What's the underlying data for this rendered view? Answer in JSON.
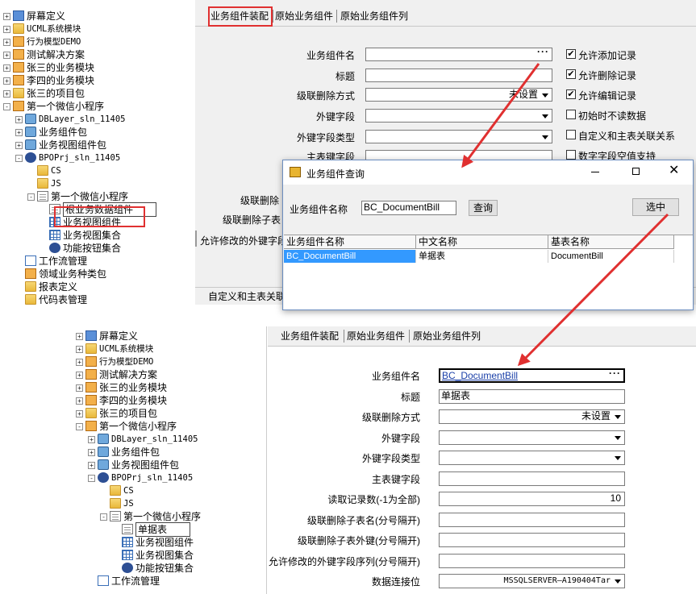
{
  "top": {
    "tree": [
      {
        "label": "屏幕定义",
        "level": 0,
        "exp": "+",
        "icon": "screen-icon",
        "mono": false
      },
      {
        "label": "UCML系统模块",
        "level": 0,
        "exp": "+",
        "icon": "folder-icon",
        "mono": true
      },
      {
        "label": "行为模型DEMO",
        "level": 0,
        "exp": "+",
        "icon": "model-icon",
        "mono": true
      },
      {
        "label": "测试解决方案",
        "level": 0,
        "exp": "+",
        "icon": "model-icon",
        "mono": false
      },
      {
        "label": "张三的业务模块",
        "level": 0,
        "exp": "+",
        "icon": "model-icon",
        "mono": false
      },
      {
        "label": "李四的业务模块",
        "level": 0,
        "exp": "+",
        "icon": "model-icon",
        "mono": false
      },
      {
        "label": "张三的项目包",
        "level": 0,
        "exp": "+",
        "icon": "folder-icon",
        "mono": false
      },
      {
        "label": "第一个微信小程序",
        "level": 0,
        "exp": "-",
        "icon": "model-icon",
        "mono": false
      },
      {
        "label": "DBLayer_sln_11405",
        "level": 1,
        "exp": "+",
        "icon": "package-icon",
        "mono": true
      },
      {
        "label": "业务组件包",
        "level": 1,
        "exp": "+",
        "icon": "package-icon",
        "mono": false
      },
      {
        "label": "业务视图组件包",
        "level": 1,
        "exp": "+",
        "icon": "package-icon",
        "mono": false
      },
      {
        "label": "BPOPrj_sln_11405",
        "level": 1,
        "exp": "-",
        "icon": "gear-icon",
        "mono": true
      },
      {
        "label": "CS",
        "level": 2,
        "exp": "",
        "icon": "folder-icon",
        "mono": true
      },
      {
        "label": "JS",
        "level": 2,
        "exp": "",
        "icon": "folder-icon",
        "mono": true
      },
      {
        "label": "第一个微信小程序",
        "level": 2,
        "exp": "-",
        "icon": "page-icon",
        "mono": false
      },
      {
        "label": "根业务数据组件",
        "level": 3,
        "exp": "",
        "icon": "doc-icon",
        "mono": false
      },
      {
        "label": "业务视图组件",
        "level": 3,
        "exp": "",
        "icon": "grid-icon",
        "mono": false
      },
      {
        "label": "业务视图集合",
        "level": 3,
        "exp": "",
        "icon": "grid-icon",
        "mono": false
      },
      {
        "label": "功能按钮集合",
        "level": 3,
        "exp": "",
        "icon": "gear-icon",
        "mono": false
      },
      {
        "label": "工作流管理",
        "level": 1,
        "exp": "",
        "icon": "flow-icon",
        "mono": false
      },
      {
        "label": "领域业务种类包",
        "level": 1,
        "exp": "",
        "icon": "model-icon",
        "mono": false
      },
      {
        "label": "报表定义",
        "level": 1,
        "exp": "",
        "icon": "folder-icon",
        "mono": false
      },
      {
        "label": "代码表管理",
        "level": 1,
        "exp": "",
        "icon": "folder-icon",
        "mono": false
      }
    ],
    "tabs": [
      "业务组件装配",
      "原始业务组件",
      "原始业务组件列"
    ],
    "form": {
      "component_name_label": "业务组件名",
      "title_label": "标题",
      "cascade_label": "级联删除方式",
      "cascade_value": "未设置",
      "fk_label": "外键字段",
      "fk_type_label": "外键字段类型",
      "pk_label": "主表键字段",
      "read_label": "读取",
      "cascade_table_label": "级联删除",
      "cascade_fk_label": "级联删除子表",
      "allow_fk_label": "允许修改的外键字段"
    },
    "checkboxes": [
      {
        "label": "允许添加记录",
        "checked": true
      },
      {
        "label": "允许删除记录",
        "checked": true
      },
      {
        "label": "允许编辑记录",
        "checked": true
      },
      {
        "label": "初始时不读数据",
        "checked": false
      },
      {
        "label": "自定义和主表关联关系",
        "checked": false
      },
      {
        "label": "数字字段空值支持",
        "checked": false
      }
    ],
    "bottom_tab": "自定义和主表关联"
  },
  "dialog": {
    "title": "业务组件查询",
    "name_label": "业务组件名称",
    "name_value": "BC_DocumentBill",
    "query_button": "查询",
    "select_button": "选中",
    "columns": [
      "业务组件名称",
      "中文名称",
      "基表名称"
    ],
    "rows": [
      [
        "BC_DocumentBill",
        "单据表",
        "DocumentBill"
      ]
    ]
  },
  "bottom": {
    "tree": [
      {
        "label": "屏幕定义",
        "level": 0,
        "exp": "+",
        "icon": "screen-icon",
        "mono": false
      },
      {
        "label": "UCML系统模块",
        "level": 0,
        "exp": "+",
        "icon": "folder-icon",
        "mono": true
      },
      {
        "label": "行为模型DEMO",
        "level": 0,
        "exp": "+",
        "icon": "model-icon",
        "mono": true
      },
      {
        "label": "测试解决方案",
        "level": 0,
        "exp": "+",
        "icon": "model-icon",
        "mono": false
      },
      {
        "label": "张三的业务模块",
        "level": 0,
        "exp": "+",
        "icon": "model-icon",
        "mono": false
      },
      {
        "label": "李四的业务模块",
        "level": 0,
        "exp": "+",
        "icon": "model-icon",
        "mono": false
      },
      {
        "label": "张三的项目包",
        "level": 0,
        "exp": "+",
        "icon": "folder-icon",
        "mono": false
      },
      {
        "label": "第一个微信小程序",
        "level": 0,
        "exp": "-",
        "icon": "model-icon",
        "mono": false
      },
      {
        "label": "DBLayer_sln_11405",
        "level": 1,
        "exp": "+",
        "icon": "package-icon",
        "mono": true
      },
      {
        "label": "业务组件包",
        "level": 1,
        "exp": "+",
        "icon": "package-icon",
        "mono": false
      },
      {
        "label": "业务视图组件包",
        "level": 1,
        "exp": "+",
        "icon": "package-icon",
        "mono": false
      },
      {
        "label": "BPOPrj_sln_11405",
        "level": 1,
        "exp": "-",
        "icon": "gear-icon",
        "mono": true
      },
      {
        "label": "CS",
        "level": 2,
        "exp": "",
        "icon": "folder-icon",
        "mono": true
      },
      {
        "label": "JS",
        "level": 2,
        "exp": "",
        "icon": "folder-icon",
        "mono": true
      },
      {
        "label": "第一个微信小程序",
        "level": 2,
        "exp": "-",
        "icon": "page-icon",
        "mono": false
      },
      {
        "label": "单据表",
        "level": 3,
        "exp": "",
        "icon": "doc-icon",
        "mono": false
      },
      {
        "label": "业务视图组件",
        "level": 3,
        "exp": "",
        "icon": "grid-icon",
        "mono": false
      },
      {
        "label": "业务视图集合",
        "level": 3,
        "exp": "",
        "icon": "grid-icon",
        "mono": false
      },
      {
        "label": "功能按钮集合",
        "level": 3,
        "exp": "",
        "icon": "gear-icon",
        "mono": false
      },
      {
        "label": "工作流管理",
        "level": 1,
        "exp": "",
        "icon": "flow-icon",
        "mono": false
      }
    ],
    "tabs": [
      "业务组件装配",
      "原始业务组件",
      "原始业务组件列"
    ],
    "form": [
      {
        "label": "业务组件名",
        "value": "BC_DocumentBill",
        "kind": "lookup"
      },
      {
        "label": "标题",
        "value": "单据表",
        "kind": "text"
      },
      {
        "label": "级联删除方式",
        "value": "未设置",
        "kind": "select"
      },
      {
        "label": "外键字段",
        "value": "",
        "kind": "select"
      },
      {
        "label": "外键字段类型",
        "value": "",
        "kind": "select"
      },
      {
        "label": "主表键字段",
        "value": "",
        "kind": "text"
      },
      {
        "label": "读取记录数(-1为全部)",
        "value": "10",
        "kind": "number"
      },
      {
        "label": "级联删除子表名(分号隔开)",
        "value": "",
        "kind": "text"
      },
      {
        "label": "级联删除子表外键(分号隔开)",
        "value": "",
        "kind": "text"
      },
      {
        "label": "允许修改的外键字段序列(分号隔开)",
        "value": "",
        "kind": "text"
      },
      {
        "label": "数据连接位",
        "value": "MSSQLSERVER—A190404Tar",
        "kind": "select"
      }
    ]
  },
  "colors": {
    "highlight": "#e03030",
    "selection": "#3399ff",
    "link": "#1a3fa8"
  }
}
